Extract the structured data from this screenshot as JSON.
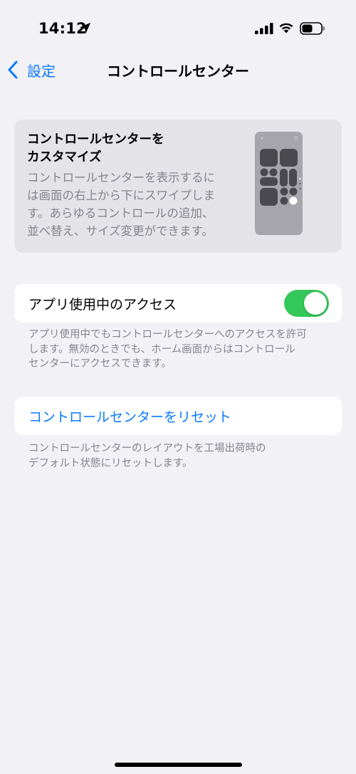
{
  "status_bar": {
    "time": "14:12",
    "icons": [
      "location-arrow-icon",
      "cellular-signal-icon",
      "wifi-icon",
      "battery-icon"
    ]
  },
  "nav": {
    "back_label": "設定",
    "title": "コントロールセンター"
  },
  "info_card": {
    "title": "コントロールセンターを\nカスタマイズ",
    "title_line1": "コントロールセンターを",
    "title_line2": "カスタマイズ",
    "description_lines": [
      "コントロールセンターを表示するに",
      "は画面の右上から下にスワイプしま",
      "す。あらゆるコントロールの追加、",
      "並べ替え、サイズ変更ができます。"
    ]
  },
  "access_row": {
    "label": "アプリ使用中のアクセス",
    "toggle_on": true,
    "footnote_lines": [
      "アプリ使用中でもコントロールセンターへのアクセスを許可",
      "します。無効のときでも、ホーム画面からはコントロール",
      "センターにアクセスできます。"
    ]
  },
  "reset_row": {
    "label": "コントロールセンターをリセット",
    "footnote_lines": [
      "コントロールセンターのレイアウトを工場出荷時の",
      "デフォルト状態にリセットします。"
    ]
  },
  "colors": {
    "background": "#f2f1f6",
    "accent": "#0a7aff",
    "toggle_on": "#34c759",
    "secondary_text": "#85848a"
  }
}
